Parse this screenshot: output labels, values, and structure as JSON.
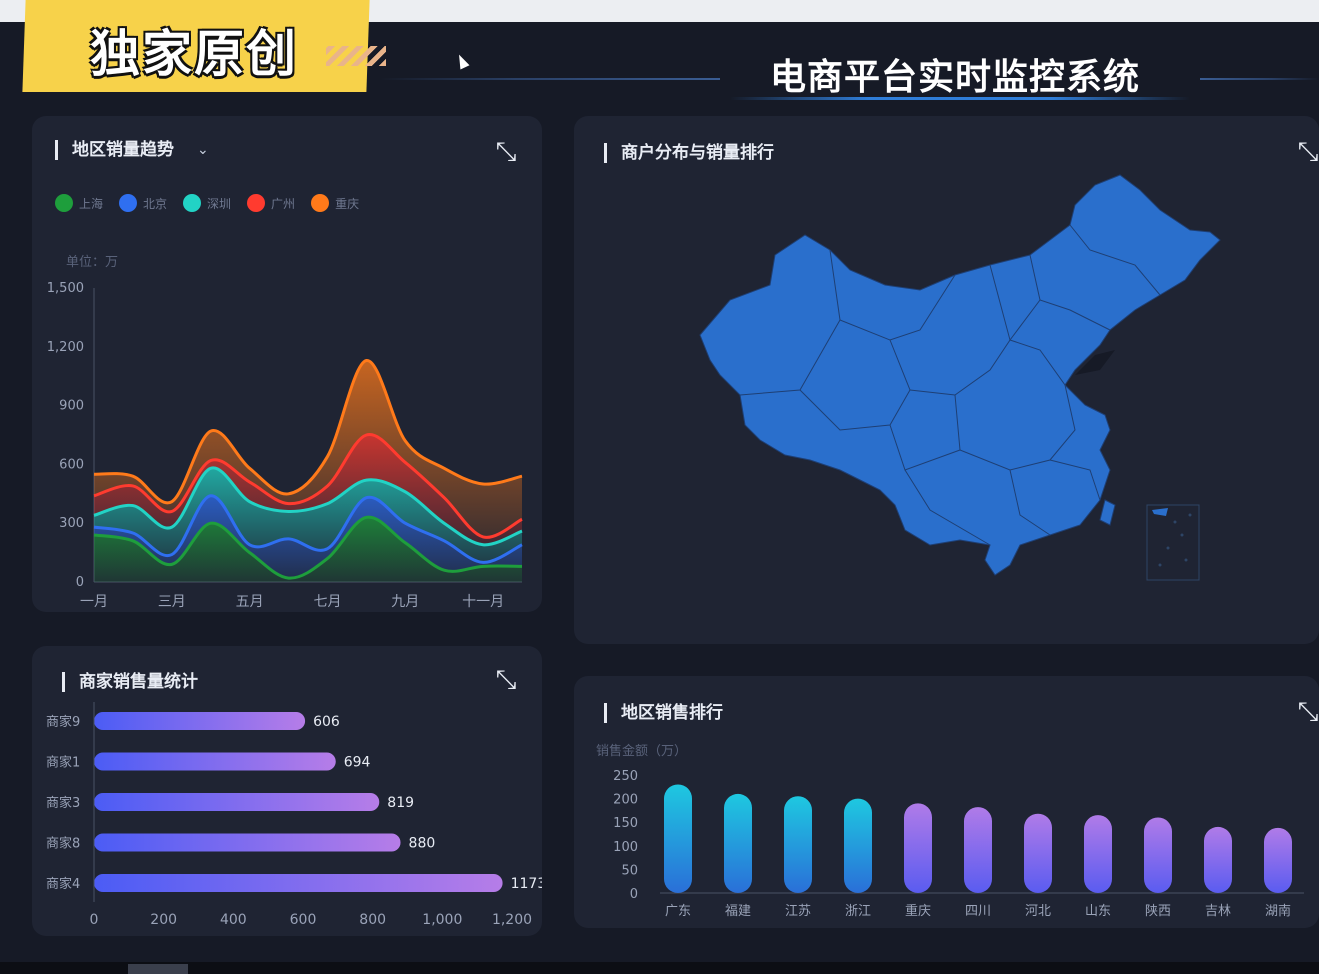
{
  "badge": {
    "text": "独家原创"
  },
  "header": {
    "title": "电商平台实时监控系统"
  },
  "trend": {
    "title": "地区销量趋势",
    "unit": "单位：万",
    "colors": [
      "#1e9e3c",
      "#2f6ff0",
      "#22d3c5",
      "#ff3b2f",
      "#ff7a1a"
    ]
  },
  "map_panel": {
    "title": "商户分布与销量排行",
    "fill": "#2a6fcc"
  },
  "merchants": {
    "title": "商家销售量统计"
  },
  "ranking": {
    "title": "地区销售排行",
    "unit": "销售金额（万）"
  },
  "chart_data": [
    {
      "type": "area",
      "title": "地区销量趋势",
      "ylabel": "单位：万",
      "x": [
        "一月",
        "二月",
        "三月",
        "四月",
        "五月",
        "六月",
        "七月",
        "八月",
        "九月",
        "十月",
        "十一月",
        "十二月"
      ],
      "x_tick_labels": [
        "一月",
        "三月",
        "五月",
        "七月",
        "九月",
        "十一月"
      ],
      "y_ticks": [
        0,
        300,
        600,
        900,
        1200,
        1500
      ],
      "y_tick_labels": [
        "0",
        "300",
        "600",
        "900",
        "1,200",
        "1,500"
      ],
      "ylim": [
        0,
        1500
      ],
      "stacked": true,
      "legend_position": "top-left",
      "series": [
        {
          "name": "上海",
          "values": [
            240,
            210,
            90,
            300,
            150,
            20,
            120,
            330,
            200,
            60,
            80,
            80
          ]
        },
        {
          "name": "北京",
          "values": [
            40,
            40,
            50,
            140,
            40,
            200,
            50,
            100,
            100,
            150,
            20,
            110
          ]
        },
        {
          "name": "深圳",
          "values": [
            60,
            140,
            140,
            140,
            220,
            140,
            230,
            90,
            160,
            90,
            90,
            70
          ]
        },
        {
          "name": "广州",
          "values": [
            100,
            100,
            80,
            40,
            100,
            40,
            90,
            230,
            150,
            130,
            40,
            60
          ]
        },
        {
          "name": "重庆",
          "values": [
            110,
            50,
            50,
            150,
            70,
            50,
            150,
            380,
            110,
            150,
            270,
            220
          ]
        }
      ]
    },
    {
      "type": "bar",
      "orientation": "horizontal",
      "title": "商家销售量统计",
      "categories": [
        "商家9",
        "商家1",
        "商家3",
        "商家8",
        "商家4"
      ],
      "values": [
        606,
        694,
        819,
        880,
        1173
      ],
      "value_labels": [
        "606",
        "694",
        "819",
        "880",
        "1173"
      ],
      "x_ticks": [
        0,
        200,
        400,
        600,
        800,
        1000,
        1200
      ],
      "x_tick_labels": [
        "0",
        "200",
        "400",
        "600",
        "800",
        "1,000",
        "1,200"
      ],
      "xlim": [
        0,
        1200
      ]
    },
    {
      "type": "bar",
      "title": "地区销售排行",
      "ylabel": "销售金额（万）",
      "categories": [
        "广东",
        "福建",
        "江苏",
        "浙江",
        "重庆",
        "四川",
        "河北",
        "山东",
        "陕西",
        "吉林",
        "湖南"
      ],
      "values": [
        230,
        210,
        205,
        200,
        190,
        182,
        168,
        165,
        160,
        140,
        138
      ],
      "y_ticks": [
        0,
        50,
        100,
        150,
        200,
        250
      ],
      "y_tick_labels": [
        "0",
        "50",
        "100",
        "150",
        "200",
        "250"
      ],
      "ylim": [
        0,
        250
      ]
    }
  ]
}
